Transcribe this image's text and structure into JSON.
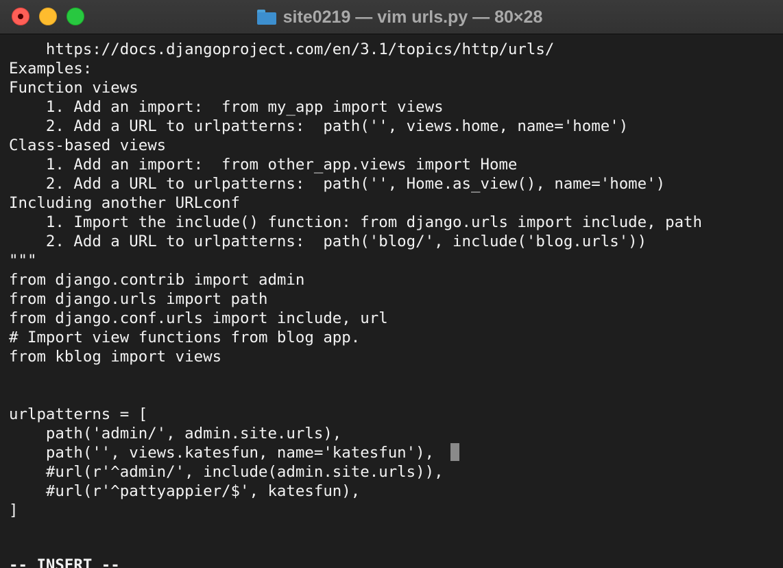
{
  "window": {
    "title": "site0219 — vim urls.py — 80×28",
    "icon": "folder-icon"
  },
  "editor": {
    "mode": "-- INSERT --",
    "lines": [
      "    https://docs.djangoproject.com/en/3.1/topics/http/urls/",
      "Examples:",
      "Function views",
      "    1. Add an import:  from my_app import views",
      "    2. Add a URL to urlpatterns:  path('', views.home, name='home')",
      "Class-based views",
      "    1. Add an import:  from other_app.views import Home",
      "    2. Add a URL to urlpatterns:  path('', Home.as_view(), name='home')",
      "Including another URLconf",
      "    1. Import the include() function: from django.urls import include, path",
      "    2. Add a URL to urlpatterns:  path('blog/', include('blog.urls'))",
      "\"\"\"",
      "from django.contrib import admin",
      "from django.urls import path",
      "from django.conf.urls import include, url",
      "# Import view functions from blog app.",
      "from kblog import views",
      "",
      "",
      "urlpatterns = [",
      "    path('admin/', admin.site.urls),",
      "    path('', views.katesfun, name='katesfun'),",
      "    #url(r'^admin/', include(admin.site.urls)),",
      "    #url(r'^pattyappier/$', katesfun),",
      "]",
      "",
      ""
    ]
  },
  "colors": {
    "background": "#1e1e1e",
    "text": "#f2f2f2",
    "cursor": "#8a8a8a",
    "close": "#ff5f57",
    "minimize": "#febc2e",
    "zoom": "#28c840"
  }
}
